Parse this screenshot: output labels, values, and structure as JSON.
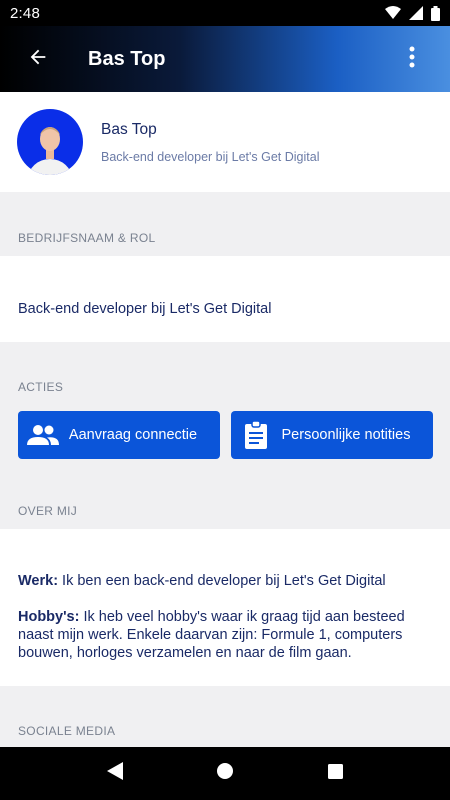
{
  "status": {
    "time": "2:48"
  },
  "app_bar": {
    "title": "Bas Top"
  },
  "profile": {
    "name": "Bas Top",
    "subtitle": "Back-end developer bij Let's Get Digital"
  },
  "sections": {
    "role_header": "BEDRIJFSNAAM & ROL",
    "actions_header": "ACTIES",
    "about_header": "OVER MIJ",
    "social_header": "SOCIALE MEDIA"
  },
  "role": {
    "text": "Back-end developer bij Let's Get Digital"
  },
  "actions": {
    "connect_label": "Aanvraag connectie",
    "notes_label": "Persoonlijke notities"
  },
  "about": {
    "work_label": "Werk:",
    "work_text": " Ik ben een back-end developer bij Let's Get Digital",
    "hobby_label": "Hobby's:",
    "hobby_text": " Ik heb veel hobby's waar ik graag tijd aan besteed naast mijn werk. Enkele daarvan zijn: Formule 1, computers bouwen, horloges verzamelen en naar de film gaan."
  },
  "colors": {
    "accent": "#0b55d9",
    "text_primary": "#1a2a66"
  },
  "icons": {
    "back": "arrow-back-icon",
    "menu": "more-vert-icon",
    "connect": "people-icon",
    "notes": "clipboard-icon"
  }
}
